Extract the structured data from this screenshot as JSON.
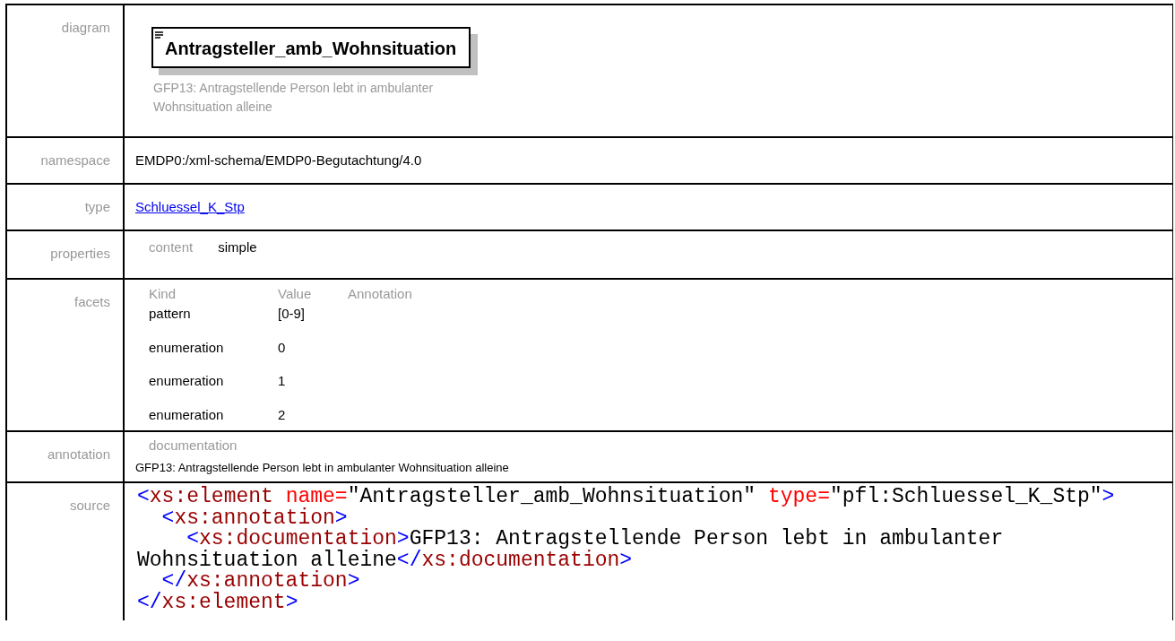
{
  "rows": [
    {
      "kind": "diagram",
      "label": "diagram",
      "element": "Antragsteller_amb_Wohnsituation",
      "description": "GFP13: Antragstellende Person lebt in ambulanter Wohnsituation alleine"
    },
    {
      "kind": "text",
      "label": "namespace",
      "value": "EMDP0:/xml-schema/EMDP0-Begutachtung/4.0"
    },
    {
      "kind": "link",
      "label": "type",
      "value": "Schluessel_K_Stp"
    },
    {
      "kind": "properties",
      "label": "properties",
      "items": [
        {
          "name": "content",
          "value": "simple"
        }
      ]
    },
    {
      "kind": "facets",
      "label": "facets",
      "columns": [
        "Kind",
        "Value",
        "Annotation"
      ],
      "facets": [
        {
          "kind": "pattern",
          "value": "[0-9]"
        },
        {
          "kind": "enumeration",
          "value": "0"
        },
        {
          "kind": "enumeration",
          "value": "1"
        },
        {
          "kind": "enumeration",
          "value": "2"
        }
      ]
    },
    {
      "kind": "annotation",
      "label": "annotation",
      "heading": "documentation",
      "text": "GFP13: Antragstellende Person lebt in ambulanter Wohnsituation alleine"
    },
    {
      "kind": "source",
      "label": "source",
      "lines": [
        {
          "kind": "root",
          "tokens": [
            {
              "kind": "bracket",
              "s": "<"
            },
            {
              "kind": "tag",
              "s": "xs:element"
            },
            {
              "kind": "attr",
              "s": "name="
            },
            {
              "kind": "value",
              "s": "\"Antragsteller_amb_Wohnsituation\""
            },
            {
              "kind": "attr",
              "s": "type="
            },
            {
              "kind": "value",
              "s": "\"pfl:Schluessel_K_Stp\""
            },
            {
              "kind": "bracket",
              "s": ">"
            }
          ]
        },
        {
          "kind": "child",
          "tokens": [
            {
              "kind": "bracket",
              "s": "<"
            },
            {
              "kind": "tag",
              "s": "xs:annotation"
            },
            {
              "kind": "bracket",
              "s": ">"
            }
          ]
        },
        {
          "kind": "grandchild",
          "tokens": [
            {
              "kind": "bracket",
              "s": "<"
            },
            {
              "kind": "tag",
              "s": "xs:documentation"
            },
            {
              "kind": "bracket",
              "s": ">"
            },
            {
              "kind": "text",
              "s": "GFP13: Antragstellende Person lebt in ambulanter"
            }
          ]
        },
        {
          "kind": "root",
          "tokens": [
            {
              "kind": "text",
              "s": "Wohnsituation alleine"
            },
            {
              "kind": "bracket",
              "s": "</"
            },
            {
              "kind": "tag",
              "s": "xs:documentation"
            },
            {
              "kind": "bracket",
              "s": ">"
            }
          ]
        },
        {
          "kind": "child",
          "tokens": [
            {
              "kind": "bracket",
              "s": "</"
            },
            {
              "kind": "tag",
              "s": "xs:annotation"
            },
            {
              "kind": "bracket",
              "s": ">"
            }
          ]
        },
        {
          "kind": "root",
          "tokens": [
            {
              "kind": "bracket",
              "s": "</"
            },
            {
              "kind": "tag",
              "s": "xs:element"
            },
            {
              "kind": "bracket",
              "s": ">"
            }
          ]
        }
      ]
    }
  ]
}
